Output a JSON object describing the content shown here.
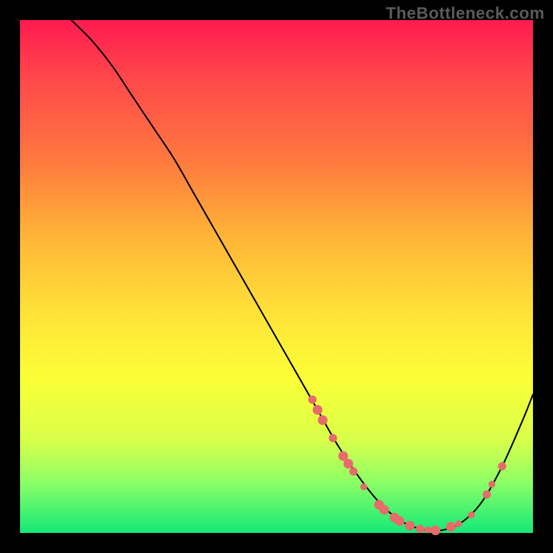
{
  "watermark": "TheBottleneck.com",
  "colors": {
    "background": "#000000",
    "gradient_top": "#ff1a50",
    "gradient_bottom": "#14e978",
    "curve": "#000000",
    "marker": "#e86a6a"
  },
  "chart_data": {
    "type": "line",
    "title": "",
    "xlabel": "",
    "ylabel": "",
    "xlim": [
      0,
      100
    ],
    "ylim": [
      0,
      100
    ],
    "grid": false,
    "series": [
      {
        "name": "bottleneck-curve",
        "x": [
          10,
          14,
          18,
          22,
          26,
          30,
          34,
          38,
          42,
          46,
          50,
          54,
          58,
          62,
          66,
          70,
          74,
          78,
          82,
          86,
          90,
          94,
          98,
          100
        ],
        "y": [
          100,
          96,
          91,
          85,
          79,
          73,
          66,
          59,
          52,
          45,
          38,
          31,
          24,
          17,
          11,
          6,
          2.5,
          0.8,
          0.5,
          2,
          6,
          13,
          22,
          27
        ]
      }
    ],
    "markers": {
      "name": "highlight-points",
      "radius_small": 5,
      "radius_large": 7,
      "points": [
        {
          "x": 57,
          "y": 26,
          "r": 6
        },
        {
          "x": 58,
          "y": 24,
          "r": 7
        },
        {
          "x": 59,
          "y": 22,
          "r": 7
        },
        {
          "x": 61,
          "y": 18.5,
          "r": 6
        },
        {
          "x": 63,
          "y": 15,
          "r": 7
        },
        {
          "x": 64,
          "y": 13.5,
          "r": 7
        },
        {
          "x": 65,
          "y": 12,
          "r": 6
        },
        {
          "x": 67,
          "y": 9,
          "r": 5
        },
        {
          "x": 70,
          "y": 5.5,
          "r": 7
        },
        {
          "x": 71,
          "y": 4.5,
          "r": 7
        },
        {
          "x": 73,
          "y": 3,
          "r": 7
        },
        {
          "x": 74,
          "y": 2.3,
          "r": 7
        },
        {
          "x": 76,
          "y": 1.4,
          "r": 7
        },
        {
          "x": 78,
          "y": 0.8,
          "r": 6
        },
        {
          "x": 79.5,
          "y": 0.6,
          "r": 5
        },
        {
          "x": 81,
          "y": 0.5,
          "r": 7
        },
        {
          "x": 84,
          "y": 1.2,
          "r": 7
        },
        {
          "x": 85.5,
          "y": 1.8,
          "r": 5
        },
        {
          "x": 88,
          "y": 3.5,
          "r": 5
        },
        {
          "x": 91,
          "y": 7.5,
          "r": 6
        },
        {
          "x": 92,
          "y": 9.5,
          "r": 5
        },
        {
          "x": 94,
          "y": 13,
          "r": 6
        }
      ]
    }
  }
}
